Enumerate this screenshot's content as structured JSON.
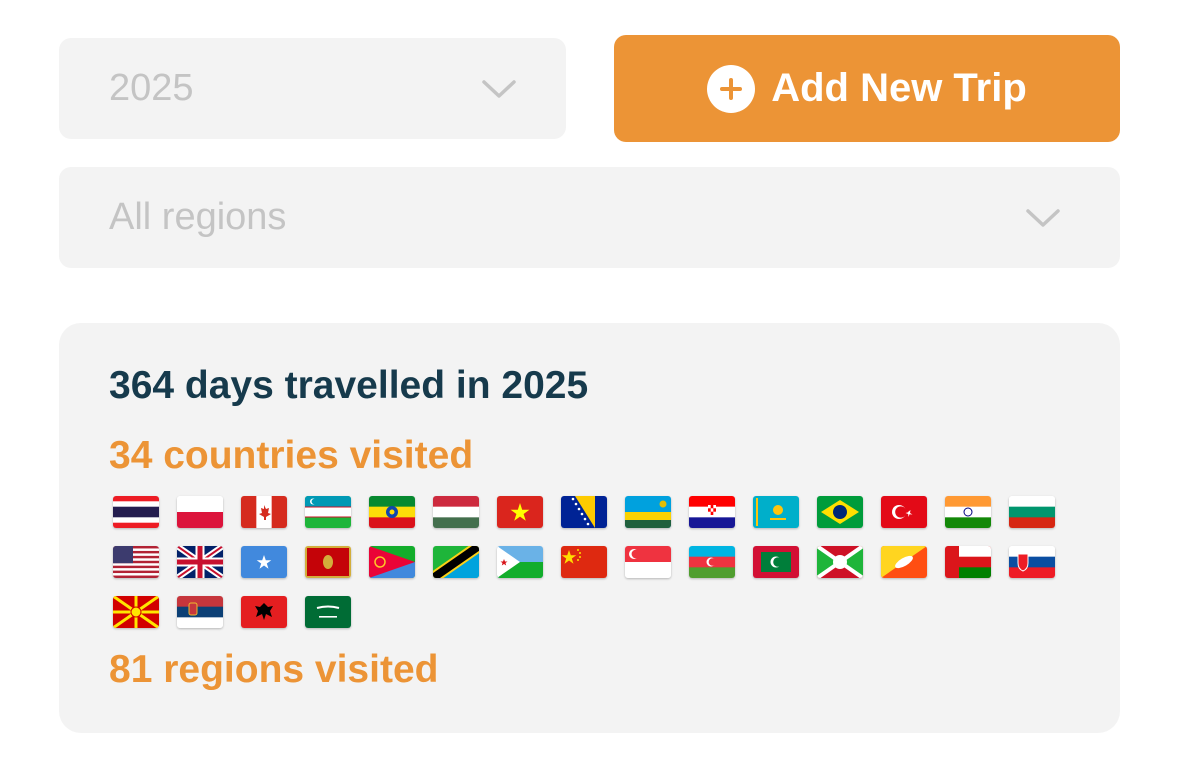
{
  "filters": {
    "year": {
      "value": "2025",
      "icon": "chevron-down-icon"
    },
    "region": {
      "value": "All regions",
      "icon": "chevron-down-icon"
    }
  },
  "add_trip_button": {
    "label": "Add New Trip",
    "icon": "plus-circle-icon",
    "color": "#ec9436"
  },
  "summary": {
    "days_text": "364 days travelled in 2025",
    "countries_text": "34 countries visited",
    "regions_text": "81 regions visited",
    "accent_color": "#ec9436",
    "heading_color": "#163a4c",
    "flags": [
      "thailand-flag-icon",
      "poland-flag-icon",
      "canada-flag-icon",
      "uzbekistan-flag-icon",
      "ethiopia-flag-icon",
      "hungary-flag-icon",
      "vietnam-flag-icon",
      "bosnia-and-herzegovina-flag-icon",
      "rwanda-flag-icon",
      "croatia-flag-icon",
      "kazakhstan-flag-icon",
      "brazil-flag-icon",
      "turkey-flag-icon",
      "india-flag-icon",
      "bulgaria-flag-icon",
      "united-states-flag-icon",
      "united-kingdom-flag-icon",
      "somalia-flag-icon",
      "montenegro-flag-icon",
      "eritrea-flag-icon",
      "tanzania-flag-icon",
      "djibouti-flag-icon",
      "china-flag-icon",
      "singapore-flag-icon",
      "azerbaijan-flag-icon",
      "maldives-flag-icon",
      "burundi-flag-icon",
      "bhutan-flag-icon",
      "oman-flag-icon",
      "slovakia-flag-icon",
      "north-macedonia-flag-icon",
      "serbia-flag-icon",
      "albania-flag-icon",
      "saudi-arabia-flag-icon"
    ]
  }
}
